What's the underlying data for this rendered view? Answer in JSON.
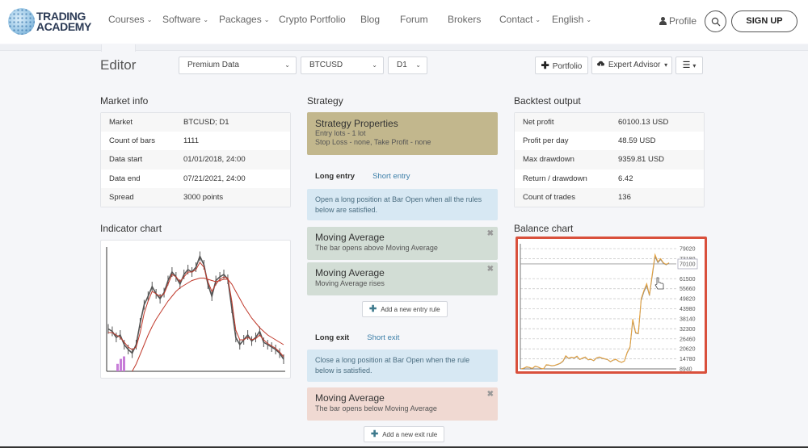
{
  "brand": {
    "line1": "TRADING",
    "line2": "ACADEMY",
    "icon": "globe-logo-icon"
  },
  "nav": {
    "items": [
      {
        "label": "Courses",
        "dropdown": true
      },
      {
        "label": "Software",
        "dropdown": true
      },
      {
        "label": "Packages",
        "dropdown": true
      },
      {
        "label": "Crypto Portfolio",
        "dropdown": false
      },
      {
        "label": "Blog",
        "dropdown": false
      },
      {
        "label": "Forum",
        "dropdown": false
      },
      {
        "label": "Brokers",
        "dropdown": false
      },
      {
        "label": "Contact",
        "dropdown": true
      },
      {
        "label": "English",
        "dropdown": true
      }
    ],
    "chevron": "⌄",
    "profile_label": "Profile",
    "signup_label": "SIGN UP"
  },
  "toolbar": {
    "title": "Editor",
    "data_source": "Premium Data",
    "symbol": "BTCUSD",
    "timeframe": "D1",
    "caret": "⌄",
    "portfolio_label": "Portfolio",
    "expert_advisor_label": "Expert Advisor",
    "menu_caret": "▾",
    "plus": "✚",
    "menu_icon": "☰"
  },
  "market_info": {
    "title": "Market info",
    "rows": [
      {
        "key": "Market",
        "value": "BTCUSD; D1"
      },
      {
        "key": "Count of bars",
        "value": "1111"
      },
      {
        "key": "Data start",
        "value": "01/01/2018, 24:00"
      },
      {
        "key": "Data end",
        "value": "07/21/2021, 24:00"
      },
      {
        "key": "Spread",
        "value": "3000 points"
      }
    ]
  },
  "strategy": {
    "title": "Strategy",
    "properties": {
      "title": "Strategy Properties",
      "line1": "Entry lots - 1 lot",
      "line2": "Stop Loss - none, Take Profit - none"
    },
    "entry": {
      "tab_active": "Long entry",
      "tab_other": "Short entry",
      "note": "Open a long position at Bar Open when all the rules below are satisfied.",
      "rules": [
        {
          "title": "Moving Average",
          "desc": "The bar opens above Moving Average"
        },
        {
          "title": "Moving Average",
          "desc": "Moving Average rises"
        }
      ],
      "add_label": "Add a new entry rule"
    },
    "exit": {
      "tab_active": "Long exit",
      "tab_other": "Short exit",
      "note": "Close a long position at Bar Open when the rule below is satisfied.",
      "rules": [
        {
          "title": "Moving Average",
          "desc": "The bar opens below Moving Average"
        }
      ],
      "add_label": "Add a new exit rule"
    },
    "remove_glyph": "✖",
    "plus_glyph": "✚"
  },
  "backtest": {
    "title": "Backtest output",
    "rows": [
      {
        "key": "Net profit",
        "value": "60100.13 USD"
      },
      {
        "key": "Profit per day",
        "value": "48.59 USD"
      },
      {
        "key": "Max drawdown",
        "value": "9359.81 USD"
      },
      {
        "key": "Return / drawdown",
        "value": "6.42"
      },
      {
        "key": "Count of trades",
        "value": "136"
      }
    ]
  },
  "indicator_chart": {
    "title": "Indicator chart"
  },
  "balance_chart": {
    "title": "Balance chart",
    "cursor_value": "70100"
  },
  "chart_data": [
    {
      "type": "line",
      "title": "Indicator chart",
      "series": [
        {
          "name": "Price",
          "color": "#555555",
          "values": [
            0.35,
            0.33,
            0.28,
            0.3,
            0.22,
            0.18,
            0.15,
            0.22,
            0.4,
            0.55,
            0.62,
            0.7,
            0.64,
            0.6,
            0.65,
            0.75,
            0.82,
            0.78,
            0.72,
            0.8,
            0.84,
            0.82,
            0.86,
            0.95,
            0.88,
            0.72,
            0.62,
            0.75,
            0.78,
            0.8,
            0.76,
            0.52,
            0.28,
            0.22,
            0.26,
            0.3,
            0.25,
            0.28,
            0.33,
            0.24,
            0.22,
            0.2,
            0.18,
            0.15,
            0.1
          ]
        },
        {
          "name": "Fast MA",
          "color": "#c0392b",
          "values": [
            0.32,
            0.32,
            0.3,
            0.28,
            0.24,
            0.2,
            0.18,
            0.2,
            0.32,
            0.48,
            0.58,
            0.66,
            0.64,
            0.62,
            0.64,
            0.72,
            0.8,
            0.78,
            0.74,
            0.78,
            0.82,
            0.82,
            0.84,
            0.9,
            0.86,
            0.74,
            0.66,
            0.72,
            0.76,
            0.78,
            0.77,
            0.58,
            0.34,
            0.26,
            0.26,
            0.28,
            0.26,
            0.27,
            0.3,
            0.26,
            0.23,
            0.21,
            0.19,
            0.16,
            0.12
          ]
        },
        {
          "name": "Slow MA",
          "color": "#c0392b",
          "values": [
            null,
            null,
            null,
            null,
            null,
            null,
            0.0,
            0.06,
            0.14,
            0.22,
            0.3,
            0.37,
            0.43,
            0.48,
            0.53,
            0.58,
            0.62,
            0.66,
            0.69,
            0.71,
            0.73,
            0.75,
            0.76,
            0.77,
            0.77,
            0.76,
            0.75,
            0.74,
            0.75,
            0.76,
            0.76,
            0.72,
            0.66,
            0.6,
            0.54,
            0.49,
            0.44,
            0.4,
            0.36,
            0.33,
            0.3,
            0.28,
            0.26,
            0.24,
            0.22
          ]
        }
      ],
      "volume_bars": [
        0.06,
        0.1,
        0.12
      ],
      "volume_color": "#c77dd8"
    },
    {
      "type": "line",
      "title": "Balance chart",
      "y_tick_labels": [
        "79020",
        "73180",
        "70100",
        "61500",
        "55660",
        "49820",
        "43980",
        "38140",
        "32300",
        "26460",
        "20620",
        "14780",
        "8940"
      ],
      "ylim": [
        8940,
        79020
      ],
      "crosshair_y": 70100,
      "grid": true,
      "series": [
        {
          "name": "Balance",
          "color": "#e8a33c",
          "values": [
            8940,
            9400,
            10200,
            9800,
            9200,
            10600,
            10100,
            9300,
            8960,
            11400,
            11200,
            10800,
            11000,
            11600,
            12300,
            13600,
            16600,
            15200,
            15800,
            15400,
            16400,
            14500,
            15300,
            15900,
            14300,
            14600,
            13800,
            15400,
            15900,
            15300,
            14800,
            14400,
            13200,
            14100,
            14500,
            13400,
            12800,
            13600,
            18600,
            21800,
            38000,
            30200,
            29600,
            49800,
            54600,
            58600,
            52000,
            64400,
            75600,
            71400,
            73200,
            70800,
            69800,
            70800
          ]
        },
        {
          "name": "Equity",
          "color": "#888888",
          "values": [
            8940,
            9300,
            10000,
            9700,
            9100,
            10400,
            10000,
            9200,
            8940,
            11200,
            11100,
            10700,
            10900,
            11500,
            12100,
            13300,
            16200,
            15000,
            15600,
            15200,
            16100,
            14400,
            15100,
            15700,
            14200,
            14500,
            13700,
            15200,
            15700,
            15100,
            14700,
            14300,
            13100,
            14000,
            14400,
            13300,
            12700,
            13500,
            18300,
            21400,
            36800,
            29800,
            29400,
            48800,
            53800,
            57400,
            51600,
            63400,
            74400,
            70800,
            72600,
            70400,
            69600,
            70600
          ]
        }
      ]
    }
  ]
}
